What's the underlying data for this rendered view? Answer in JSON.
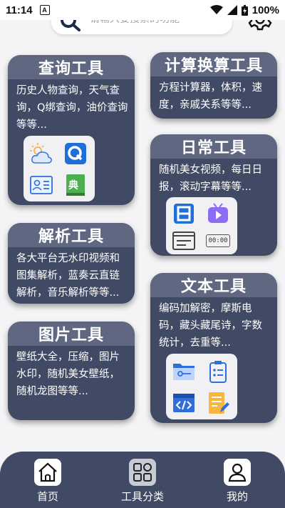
{
  "status_bar": {
    "time": "11:14",
    "notification_icon": "A",
    "battery": "100%"
  },
  "search": {
    "placeholder": "请输入要搜索的功能"
  },
  "cards": {
    "query": {
      "title": "查询工具",
      "desc": "历史人物查询，天气查询，Q绑查询，油价查询等等..."
    },
    "calc": {
      "title": "计算换算工具",
      "desc": "方程计算器，体积，速度，亲戚关系等等..."
    },
    "daily": {
      "title": "日常工具",
      "desc": "随机美女视频，每日日报，滚动字幕等等...",
      "clock_text": "00:00"
    },
    "parse": {
      "title": "解析工具",
      "desc": "各大平台无水印视频和图集解析，蓝奏云直链解析，音乐解析等等..."
    },
    "text": {
      "title": "文本工具",
      "desc": "编码加解密，摩斯电码，藏头藏尾诗，字数统计，去重等..."
    },
    "image": {
      "title": "图片工具",
      "desc": "壁纸大全，压缩，图片水印，随机美女壁纸，随机龙图等等..."
    }
  },
  "icons": {
    "query_tray": [
      "weather-icon",
      "q-icon",
      "id-card-icon",
      "dictionary-icon"
    ],
    "daily_tray": [
      "calendar-icon",
      "video-icon",
      "subtitle-icon",
      "clock-icon"
    ],
    "text_tray": [
      "folder-key-icon",
      "clipboard-icon",
      "code-window-icon",
      "note-edit-icon"
    ],
    "dictionary_glyph": "典"
  },
  "nav": {
    "home": "首页",
    "categories": "工具分类",
    "profile": "我的"
  },
  "colors": {
    "card_bg": "#404a64",
    "card_header": "#5f6880",
    "page_bg": "#f4f4f6",
    "accent_blue": "#1e6fd9"
  }
}
